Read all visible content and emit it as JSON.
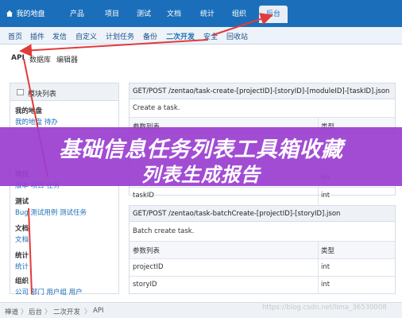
{
  "topnav": {
    "items": [
      "我的地盘",
      "产品",
      "项目",
      "测试",
      "文档",
      "统计",
      "组织",
      "后台"
    ],
    "active_index": 7
  },
  "subnav": {
    "items": [
      "首页",
      "插件",
      "发信",
      "自定义",
      "计划任务",
      "备份",
      "二次开发",
      "安全",
      "回收站"
    ],
    "highlight_index": 6
  },
  "apibar": {
    "items": [
      "API",
      "数据库",
      "编辑器"
    ]
  },
  "sidebar": {
    "title": "模块列表",
    "groups": [
      {
        "name": "我的地盘",
        "links": "我的地盘 待办"
      },
      {
        "name": "项目",
        "links": "版本 项目 任务"
      },
      {
        "name": "测试",
        "links": "Bug 测试用例 测试任务"
      },
      {
        "name": "文档",
        "links": "文档"
      },
      {
        "name": "统计",
        "links": "统计"
      },
      {
        "name": "组织",
        "links": "公司 部门 用户组 用户"
      }
    ]
  },
  "panel1": {
    "endpoint": "GET/POST  /zentao/task-create-[projectID]-[storyID]-[moduleID]-[taskID].json",
    "description": "Create a task.",
    "header": [
      "参数列表",
      "类型"
    ],
    "rows": [
      [
        "",
        "int"
      ],
      [
        "taskID",
        "int"
      ]
    ]
  },
  "panel2": {
    "endpoint": "GET/POST  /zentao/task-batchCreate-[projectID]-[storyID].json",
    "description": "Batch create task.",
    "header": [
      "参数列表",
      "类型"
    ],
    "rows": [
      [
        "projectID",
        "int"
      ],
      [
        "storyID",
        "int"
      ]
    ]
  },
  "footer": {
    "breadcrumb": [
      "禅道",
      "后台",
      "二次开发",
      "API"
    ]
  },
  "watermark": "https://blog.csdn.net/lima_36530008",
  "banner": {
    "line1": "基础信息任务列表工具箱收藏",
    "line2": "列表生成报告"
  },
  "colors": {
    "topnav": "#1b6fba",
    "banner": "#9b3fd1",
    "arrow": "#e23b3b"
  }
}
